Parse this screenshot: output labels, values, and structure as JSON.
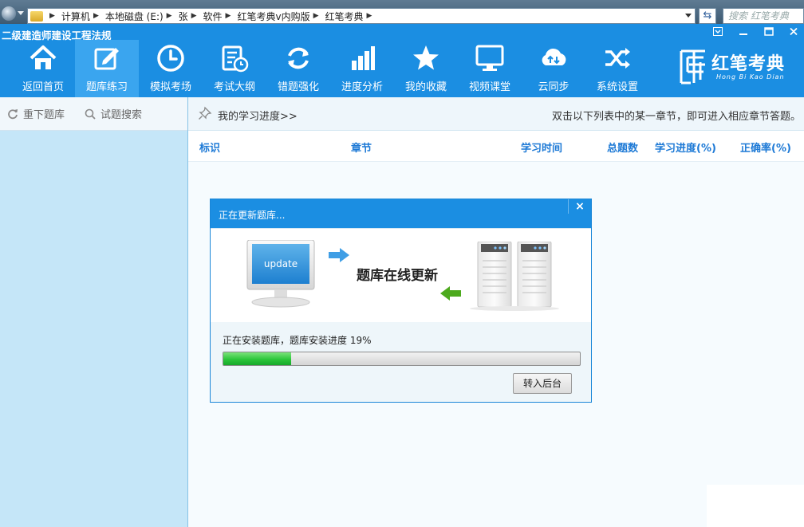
{
  "explorer": {
    "breadcrumb": [
      "计算机",
      "本地磁盘 (E:)",
      "张",
      "软件",
      "红笔考典v内购版",
      "红笔考典"
    ],
    "search_placeholder": "搜索 红笔考典"
  },
  "app": {
    "title": "二级建造师建设工程法规",
    "logo_cn": "红笔考典",
    "logo_en": "Hong Bi Kao Dian"
  },
  "nav": {
    "items": [
      {
        "label": "返回首页",
        "icon": "home-icon"
      },
      {
        "label": "题库练习",
        "icon": "edit-icon",
        "active": true
      },
      {
        "label": "模拟考场",
        "icon": "clock-icon"
      },
      {
        "label": "考试大纲",
        "icon": "schedule-icon"
      },
      {
        "label": "错题强化",
        "icon": "refresh-icon"
      },
      {
        "label": "进度分析",
        "icon": "bar-chart-icon"
      },
      {
        "label": "我的收藏",
        "icon": "star-icon"
      },
      {
        "label": "视频课堂",
        "icon": "monitor-icon"
      },
      {
        "label": "云同步",
        "icon": "cloud-sync-icon"
      },
      {
        "label": "系统设置",
        "icon": "shuffle-icon"
      }
    ]
  },
  "sidebar": {
    "reload_label": "重下题库",
    "search_label": "试题搜索"
  },
  "main": {
    "my_progress": "我的学习进度>>",
    "hint": "双击以下列表中的某一章节，即可进入相应章节答题。",
    "columns": {
      "mark": "标识",
      "chapter": "章节",
      "time": "学习时间",
      "total": "总题数",
      "progress": "学习进度(%)",
      "accuracy": "正确率(%)"
    }
  },
  "dialog": {
    "title": "正在更新题库...",
    "close": "×",
    "banner_text": "题库在线更新",
    "monitor_text": "update",
    "status": "正在安装题库，题库安装进度  19%",
    "progress": 0.19,
    "background_button": "转入后台"
  },
  "colors": {
    "header": "#1b8ee2",
    "active_nav": "#3aa5ef",
    "sidebar": "#c5e6f8",
    "column_header": "#1e7ad6",
    "progress_fill": "#2cc63a"
  }
}
